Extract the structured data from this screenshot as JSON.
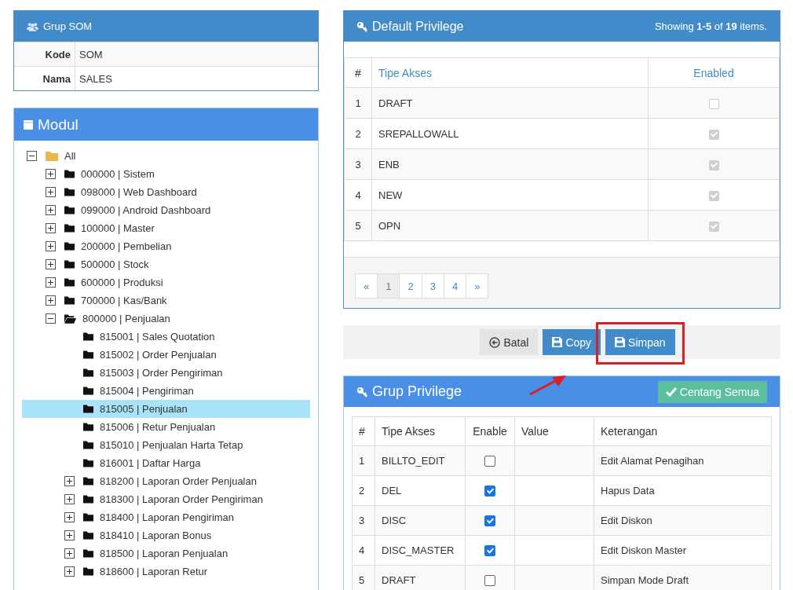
{
  "group_panel": {
    "title": "Grup SOM",
    "fields": [
      {
        "label": "Kode",
        "value": "SOM"
      },
      {
        "label": "Nama",
        "value": "SALES"
      }
    ]
  },
  "module_panel": {
    "title": "Modul",
    "tree": [
      {
        "label": "All",
        "expanded": true,
        "selected": false,
        "children": [
          {
            "label": "000000 | Sistem",
            "expanded": false,
            "selected": false
          },
          {
            "label": "098000 | Web Dashboard",
            "expanded": false,
            "selected": false
          },
          {
            "label": "099000 | Android Dashboard",
            "expanded": false,
            "selected": false
          },
          {
            "label": "100000 | Master",
            "expanded": false,
            "selected": false
          },
          {
            "label": "200000 | Pembelian",
            "expanded": false,
            "selected": false
          },
          {
            "label": "500000 | Stock",
            "expanded": false,
            "selected": false
          },
          {
            "label": "600000 | Produksi",
            "expanded": false,
            "selected": false
          },
          {
            "label": "700000 | Kas/Bank",
            "expanded": false,
            "selected": false
          },
          {
            "label": "800000 | Penjualan",
            "expanded": true,
            "selected": false,
            "children": [
              {
                "label": "815001 | Sales Quotation",
                "selected": false
              },
              {
                "label": "815002 | Order Penjualan",
                "selected": false
              },
              {
                "label": "815003 | Order Pengiriman",
                "selected": false
              },
              {
                "label": "815004 | Pengiriman",
                "selected": false
              },
              {
                "label": "815005 | Penjualan",
                "selected": true
              },
              {
                "label": "815006 | Retur Penjualan",
                "selected": false
              },
              {
                "label": "815010 | Penjualan Harta Tetap",
                "selected": false
              },
              {
                "label": "816001 | Daftar Harga",
                "selected": false
              },
              {
                "label": "818200 | Laporan Order Penjualan",
                "expanded": false,
                "selected": false
              },
              {
                "label": "818300 | Laporan Order Pengiriman",
                "expanded": false,
                "selected": false
              },
              {
                "label": "818400 | Laporan Pengiriman",
                "expanded": false,
                "selected": false
              },
              {
                "label": "818410 | Laporan Bonus",
                "expanded": false,
                "selected": false
              },
              {
                "label": "818500 | Laporan Penjualan",
                "expanded": false,
                "selected": false
              },
              {
                "label": "818600 | Laporan Retur",
                "expanded": false,
                "selected": false
              }
            ]
          }
        ]
      }
    ]
  },
  "default_privilege": {
    "title": "Default Privilege",
    "summary": "Showing **1-5** of **19** items.",
    "columns": [
      "#",
      "Tipe Akses",
      "Enabled"
    ],
    "rows": [
      {
        "no": "1",
        "type": "DRAFT",
        "checked": false
      },
      {
        "no": "2",
        "type": "SREPALLOWALL",
        "checked": true
      },
      {
        "no": "3",
        "type": "ENB",
        "checked": true
      },
      {
        "no": "4",
        "type": "NEW",
        "checked": true
      },
      {
        "no": "5",
        "type": "OPN",
        "checked": true
      }
    ],
    "pagination": [
      {
        "label": "«",
        "selected": false
      },
      {
        "label": "1",
        "selected": true
      },
      {
        "label": "2",
        "selected": false
      },
      {
        "label": "3",
        "selected": false
      },
      {
        "label": "4",
        "selected": false
      },
      {
        "label": "»",
        "selected": false
      }
    ]
  },
  "actions": [
    {
      "label": "Batal",
      "kind": "cancel"
    },
    {
      "label": "Copy",
      "kind": "save"
    },
    {
      "label": "Simpan",
      "kind": "save",
      "highlighted": true
    }
  ],
  "group_privilege": {
    "title": "Grup Privilege",
    "check_all": "Centang Semua",
    "columns": [
      "#",
      "Tipe Akses",
      "Enable",
      "Value",
      "Keterangan"
    ],
    "rows": [
      {
        "no": "1",
        "type": "BILLTO_EDIT",
        "checked": false,
        "description": "Edit Alamat Penagihan"
      },
      {
        "no": "2",
        "type": "DEL",
        "checked": true,
        "description": "Hapus Data"
      },
      {
        "no": "3",
        "type": "DISC",
        "checked": true,
        "description": "Edit Diskon"
      },
      {
        "no": "4",
        "type": "DISC_MASTER",
        "checked": true,
        "description": "Edit Diskon Master"
      },
      {
        "no": "5",
        "type": "DRAFT",
        "checked": false,
        "description": "Simpan Mode Draft"
      }
    ]
  }
}
